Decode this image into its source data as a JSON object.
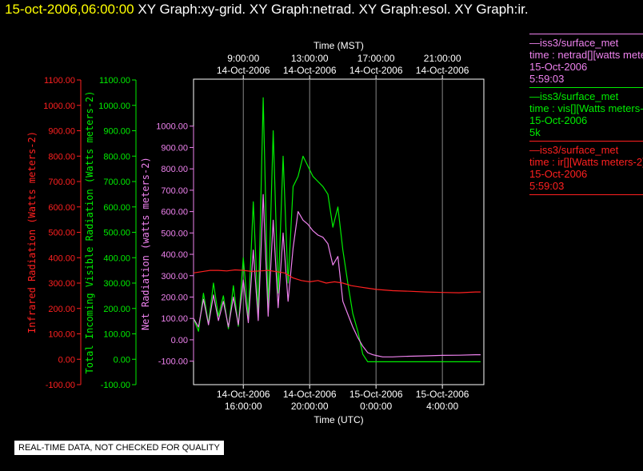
{
  "header": {
    "timestamp": "15-oct-2006,06:00:00",
    "graphs": "XY Graph:xy-grid.  XY Graph:netrad.  XY Graph:esol.  XY Graph:ir."
  },
  "colors": {
    "net": "#ee82ee",
    "vis": "#00ee00",
    "ir": "#ff2020",
    "axis": "#ffffff",
    "grid": "#888888"
  },
  "chart_data": {
    "type": "line",
    "top_axis": {
      "title": "Time (MST)",
      "ticks": [
        {
          "time": "9:00:00",
          "date": "14-Oct-2006"
        },
        {
          "time": "13:00:00",
          "date": "14-Oct-2006"
        },
        {
          "time": "17:00:00",
          "date": "14-Oct-2006"
        },
        {
          "time": "21:00:00",
          "date": "14-Oct-2006"
        }
      ]
    },
    "bottom_axis": {
      "title": "Time (UTC)",
      "ticks": [
        {
          "date": "14-Oct-2006",
          "time": "16:00:00"
        },
        {
          "date": "14-Oct-2006",
          "time": "20:00:00"
        },
        {
          "date": "15-Oct-2006",
          "time": "0:00:00"
        },
        {
          "date": "15-Oct-2006",
          "time": "4:00:00"
        }
      ]
    },
    "x_unit": "hours UTC from 14-Oct-2006 00:00",
    "xlim": [
      13.0,
      30.5
    ],
    "y_axes": [
      {
        "id": "ir",
        "label": "Infrared Radiation (Watts meters-2)",
        "ylim": [
          -100,
          1100
        ],
        "ticks": [
          "1100.00",
          "1000.00",
          "900.00",
          "800.00",
          "700.00",
          "600.00",
          "500.00",
          "400.00",
          "300.00",
          "200.00",
          "100.00",
          "0.00",
          "-100.00"
        ]
      },
      {
        "id": "vis",
        "label": "Total Incoming Visible Radiation (Watts meters-2)",
        "ylim": [
          -100,
          1100
        ],
        "ticks": [
          "1100.00",
          "1000.00",
          "900.00",
          "800.00",
          "700.00",
          "600.00",
          "500.00",
          "400.00",
          "300.00",
          "200.00",
          "100.00",
          "0.00",
          "-100.00"
        ]
      },
      {
        "id": "net",
        "label": "Net Radiation (watts meters-2)",
        "ylim": [
          -150,
          1100
        ],
        "ticks": [
          "1000.00",
          "900.00",
          "800.00",
          "700.00",
          "600.00",
          "500.00",
          "400.00",
          "300.00",
          "200.00",
          "100.00",
          "0.00",
          "-100.00"
        ]
      }
    ],
    "grid": true,
    "series": [
      {
        "axis": "vis",
        "x": [
          13.0,
          13.3,
          13.6,
          13.9,
          14.2,
          14.5,
          14.8,
          15.1,
          15.4,
          15.7,
          16.0,
          16.3,
          16.6,
          16.9,
          17.2,
          17.5,
          17.8,
          18.1,
          18.4,
          18.7,
          19.0,
          19.3,
          19.6,
          19.9,
          20.2,
          20.5,
          20.8,
          21.1,
          21.4,
          21.7,
          22.0,
          22.3,
          22.6,
          22.9,
          23.2,
          23.5,
          23.8,
          24.1,
          24.4,
          24.7,
          25.0,
          25.5,
          26.0,
          27.0,
          28.0,
          29.0,
          30.0,
          30.3
        ],
        "values": [
          160,
          110,
          260,
          140,
          300,
          170,
          250,
          120,
          290,
          130,
          400,
          170,
          620,
          180,
          1030,
          200,
          900,
          260,
          800,
          300,
          680,
          720,
          800,
          760,
          720,
          700,
          680,
          650,
          520,
          600,
          430,
          300,
          180,
          110,
          20,
          -10,
          -10,
          -10,
          -10,
          -10,
          -10,
          -10,
          -10,
          -10,
          -10,
          -10,
          -10,
          -10
        ]
      },
      {
        "axis": "net",
        "x": [
          13.0,
          13.3,
          13.6,
          13.9,
          14.2,
          14.5,
          14.8,
          15.1,
          15.4,
          15.7,
          16.0,
          16.3,
          16.6,
          16.9,
          17.2,
          17.5,
          17.8,
          18.1,
          18.4,
          18.7,
          19.0,
          19.3,
          19.6,
          19.9,
          20.2,
          20.5,
          20.8,
          21.1,
          21.4,
          21.7,
          22.0,
          22.3,
          22.6,
          22.9,
          23.2,
          23.5,
          23.8,
          24.1,
          24.4,
          24.7,
          25.0,
          25.5,
          26.0,
          27.0,
          28.0,
          29.0,
          30.0,
          30.3
        ],
        "values": [
          100,
          60,
          190,
          70,
          210,
          90,
          180,
          60,
          200,
          70,
          280,
          80,
          420,
          90,
          680,
          110,
          560,
          150,
          500,
          180,
          430,
          600,
          560,
          540,
          510,
          490,
          480,
          450,
          350,
          390,
          180,
          120,
          60,
          10,
          -30,
          -60,
          -70,
          -75,
          -80,
          -80,
          -80,
          -78,
          -77,
          -75,
          -73,
          -72,
          -70,
          -70
        ]
      },
      {
        "axis": "ir",
        "x": [
          13.0,
          13.5,
          14.0,
          14.5,
          15.0,
          15.5,
          16.0,
          16.5,
          17.0,
          17.5,
          18.0,
          18.5,
          19.0,
          19.5,
          20.0,
          20.5,
          21.0,
          21.5,
          22.0,
          22.5,
          23.0,
          23.5,
          24.0,
          25.0,
          26.0,
          27.0,
          28.0,
          29.0,
          30.0,
          30.3
        ],
        "values": [
          340,
          345,
          350,
          350,
          348,
          352,
          350,
          346,
          348,
          350,
          345,
          340,
          320,
          310,
          305,
          310,
          300,
          305,
          300,
          290,
          285,
          280,
          275,
          270,
          268,
          265,
          263,
          262,
          265,
          265
        ]
      }
    ]
  },
  "legend": [
    {
      "source": "—iss3/surface_met",
      "field": "time : netrad[][watts meters-2]",
      "date": "15-Oct-2006",
      "value": "5:59:03",
      "color": "#ee82ee"
    },
    {
      "source": "—iss3/surface_met",
      "field": "time : vis[][Watts meters-2]",
      "date": "15-Oct-2006",
      "value": "5k",
      "color": "#00ee00"
    },
    {
      "source": "—iss3/surface_met",
      "field": "time : ir[][Watts meters-2]",
      "date": "15-Oct-2006",
      "value": "5:59:03",
      "color": "#ff2020"
    }
  ],
  "notice": "REAL-TIME DATA, NOT CHECKED FOR QUALITY"
}
